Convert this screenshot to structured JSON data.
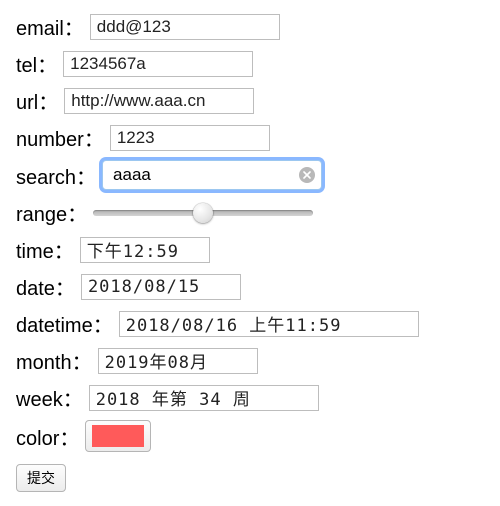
{
  "form": {
    "email": {
      "label": "email：",
      "value": "ddd@123"
    },
    "tel": {
      "label": "tel：",
      "value": "1234567a"
    },
    "url": {
      "label": "url：",
      "value": "http://www.aaa.cn"
    },
    "number": {
      "label": "number：",
      "value": "1223"
    },
    "search": {
      "label": "search：",
      "value": "aaaa"
    },
    "range": {
      "label": "range：",
      "percent": 50
    },
    "time": {
      "label": "time：",
      "value": "下午12:59"
    },
    "date": {
      "label": "date：",
      "value": "2018/08/15"
    },
    "datetime": {
      "label": "datetime：",
      "value": "2018/08/16 上午11:59"
    },
    "month": {
      "label": "month：",
      "value": "2019年08月"
    },
    "week": {
      "label": "week：",
      "value": "2018 年第 34 周"
    },
    "color": {
      "label": "color：",
      "value": "#FF5A5A"
    },
    "submit": {
      "label": "提交"
    }
  }
}
